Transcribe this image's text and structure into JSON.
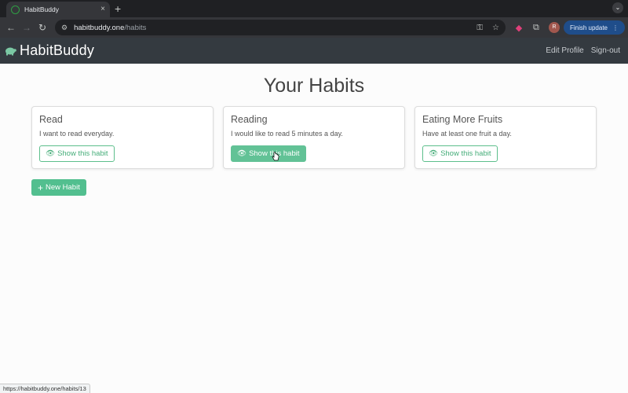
{
  "browser": {
    "tab_title": "HabitBuddy",
    "tab_close": "×",
    "new_tab": "+",
    "url_host": "habitbuddy.one",
    "url_path": "/habits",
    "finish_update_label": "Finish update",
    "profile_initial": "R",
    "status_url": "https://habitbuddy.one/habits/13"
  },
  "navbar": {
    "brand": "HabitBuddy",
    "links": [
      "Edit Profile",
      "Sign-out"
    ]
  },
  "page": {
    "title": "Your Habits",
    "habits": [
      {
        "name": "Read",
        "description": "I want to read everyday.",
        "button": "Show this habit"
      },
      {
        "name": "Reading",
        "description": "I would like to read 5 minutes a day.",
        "button": "Show this habit"
      },
      {
        "name": "Eating More Fruits",
        "description": "Have at least one fruit a day.",
        "button": "Show this habit"
      }
    ],
    "new_habit_label": "New Habit"
  },
  "colors": {
    "accent_green": "#52bf8f",
    "navbar_bg": "#343a40"
  }
}
